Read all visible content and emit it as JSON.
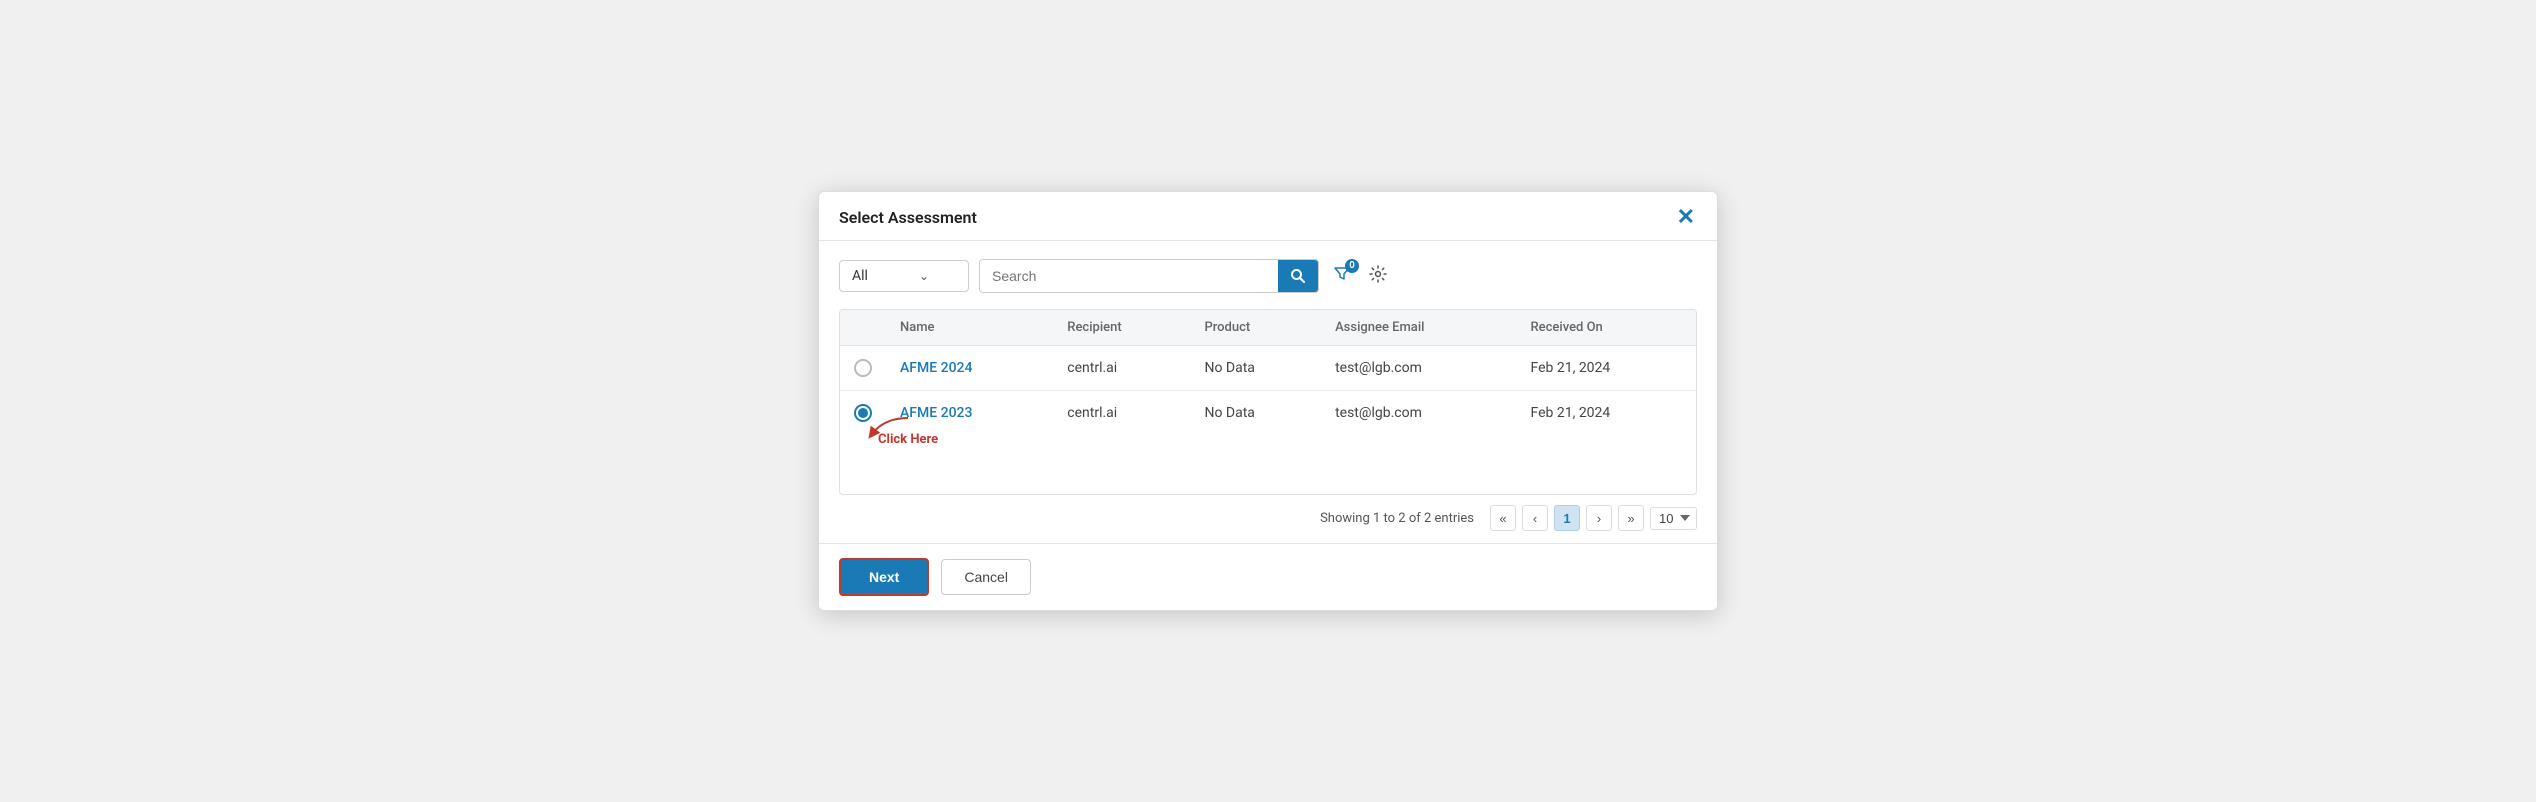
{
  "modal": {
    "title": "Select Assessment",
    "close_label": "✕"
  },
  "toolbar": {
    "filter_value": "All",
    "search_placeholder": "Search",
    "filter_badge": "0"
  },
  "table": {
    "columns": [
      "",
      "Name",
      "Recipient",
      "Product",
      "Assignee Email",
      "Received On"
    ],
    "rows": [
      {
        "selected": false,
        "name": "AFME 2024",
        "recipient": "centrl.ai",
        "product": "No Data",
        "assignee_email": "test@lgb.com",
        "received_on": "Feb 21, 2024"
      },
      {
        "selected": true,
        "name": "AFME 2023",
        "recipient": "centrl.ai",
        "product": "No Data",
        "assignee_email": "test@lgb.com",
        "received_on": "Feb 21, 2024"
      }
    ]
  },
  "pagination": {
    "info": "Showing 1 to 2 of 2 entries",
    "current_page": "1",
    "per_page": "10"
  },
  "footer": {
    "next_label": "Next",
    "cancel_label": "Cancel"
  },
  "annotation": {
    "click_here": "Click Here"
  }
}
